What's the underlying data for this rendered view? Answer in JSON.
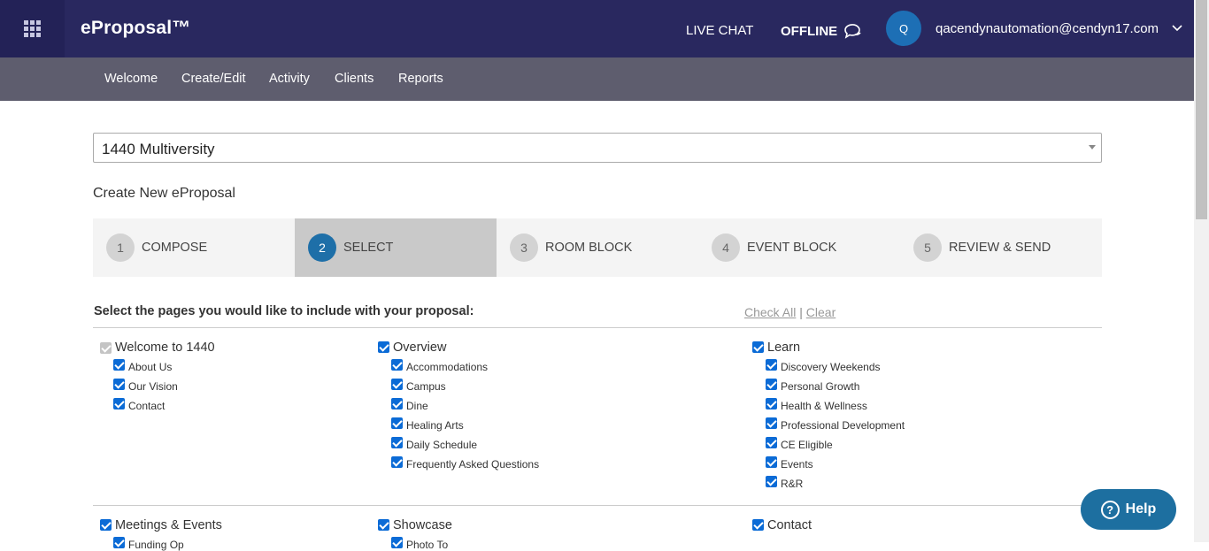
{
  "topbar": {
    "brand": "eProposal™",
    "live_chat": "LIVE CHAT",
    "offline": "OFFLINE",
    "avatar_initial": "Q",
    "user_email": "qacendynautomation@cendyn17.com"
  },
  "nav": {
    "items": [
      "Welcome",
      "Create/Edit",
      "Activity",
      "Clients",
      "Reports"
    ]
  },
  "property_select": {
    "value": "1440 Multiversity"
  },
  "page_title": "Create New eProposal",
  "steps": [
    {
      "num": "1",
      "label": "COMPOSE",
      "active": false
    },
    {
      "num": "2",
      "label": "SELECT",
      "active": true
    },
    {
      "num": "3",
      "label": "ROOM BLOCK",
      "active": false
    },
    {
      "num": "4",
      "label": "EVENT BLOCK",
      "active": false
    },
    {
      "num": "5",
      "label": "REVIEW & SEND",
      "active": false
    }
  ],
  "pages_section": {
    "heading": "Select the pages you would like to include with your proposal:",
    "check_all": "Check All",
    "separator": "|",
    "clear": "Clear",
    "groups": [
      {
        "title": "Welcome to 1440",
        "checked": true,
        "disabled": true,
        "items": [
          "About Us",
          "Our Vision",
          "Contact"
        ]
      },
      {
        "title": "Overview",
        "checked": true,
        "disabled": false,
        "items": [
          "Accommodations",
          "Campus",
          "Dine",
          "Healing Arts",
          "Daily Schedule",
          "Frequently Asked Questions"
        ]
      },
      {
        "title": "Learn",
        "checked": true,
        "disabled": false,
        "items": [
          "Discovery Weekends",
          "Personal Growth",
          "Health & Wellness",
          "Professional Development",
          "CE Eligible",
          "Events",
          "R&R"
        ]
      },
      {
        "title": "Meetings & Events",
        "checked": true,
        "disabled": false,
        "items": [
          "Funding Op"
        ]
      },
      {
        "title": "Showcase",
        "checked": true,
        "disabled": false,
        "items": [
          "Photo To"
        ]
      },
      {
        "title": "Contact",
        "checked": true,
        "disabled": false,
        "items": []
      }
    ]
  },
  "help_button": {
    "label": "Help",
    "icon": "question-icon"
  },
  "colors": {
    "topbar": "#29285f",
    "subnav": "#5e5d6e",
    "accent": "#1e6fa8",
    "checkbox": "#0b6bd6"
  }
}
